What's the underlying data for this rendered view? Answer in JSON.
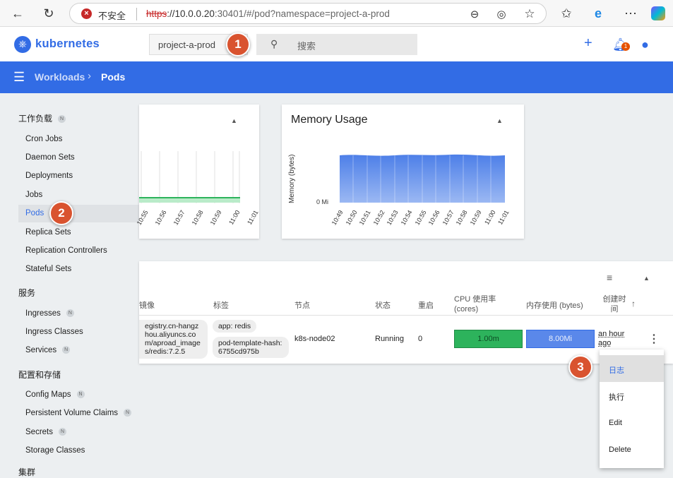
{
  "browser": {
    "insecure_label": "不安全",
    "url_scheme": "https",
    "url_host": "://10.0.0.20",
    "url_rest": ":30401/#/pod?namespace=project-a-prod"
  },
  "header": {
    "brand": "kubernetes",
    "namespace": "project-a-prod",
    "search_placeholder": "搜索",
    "notification_count": "1"
  },
  "breadcrumb": {
    "parent": "Workloads",
    "separator": "›",
    "current": "Pods"
  },
  "sidebar": {
    "section_workloads": "工作负载",
    "workloads": [
      "Cron Jobs",
      "Daemon Sets",
      "Deployments",
      "Jobs",
      "Pods",
      "Replica Sets",
      "Replication Controllers",
      "Stateful Sets"
    ],
    "section_services": "服务",
    "services": [
      "Ingresses",
      "Ingress Classes",
      "Services"
    ],
    "section_config": "配置和存储",
    "config": [
      "Config Maps",
      "Persistent Volume Claims",
      "Secrets",
      "Storage Classes"
    ],
    "section_cluster": "集群",
    "badge": "N"
  },
  "cpu_card": {
    "ticks": [
      "10:55",
      "10:56",
      "10:57",
      "10:58",
      "10:59",
      "11:00",
      "11:01"
    ]
  },
  "memory_card": {
    "title": "Memory Usage",
    "ylabel": "Memory (bytes)",
    "zero_label": "0 Mi",
    "ticks": [
      "10:49",
      "10:50",
      "10:51",
      "10:52",
      "10:53",
      "10:54",
      "10:55",
      "10:56",
      "10:57",
      "10:58",
      "10:59",
      "11:00",
      "11:01"
    ]
  },
  "table": {
    "headers": {
      "image": "镜像",
      "labels": "标签",
      "node": "节点",
      "status": "状态",
      "restarts": "重启",
      "cpu": "CPU 使用率 (cores)",
      "memory": "内存使用 (bytes)",
      "created": "创建时间"
    },
    "row": {
      "image": "egistry.cn-hangzhou.aliyuncs.com/aproad_images/redis:7.2.5",
      "label1": "app: redis",
      "label2": "pod-template-hash: 6755cd975b",
      "node": "k8s-node02",
      "status": "Running",
      "restarts": "0",
      "cpu": "1.00m",
      "memory": "8.00Mi",
      "created": "an hour ago"
    }
  },
  "context_menu": [
    "日志",
    "执行",
    "Edit",
    "Delete"
  ],
  "markers": [
    "1",
    "2",
    "3"
  ],
  "colors": {
    "primary": "#326ce5",
    "cpu_bar": "#2db35c",
    "marker": "#d9532f"
  }
}
